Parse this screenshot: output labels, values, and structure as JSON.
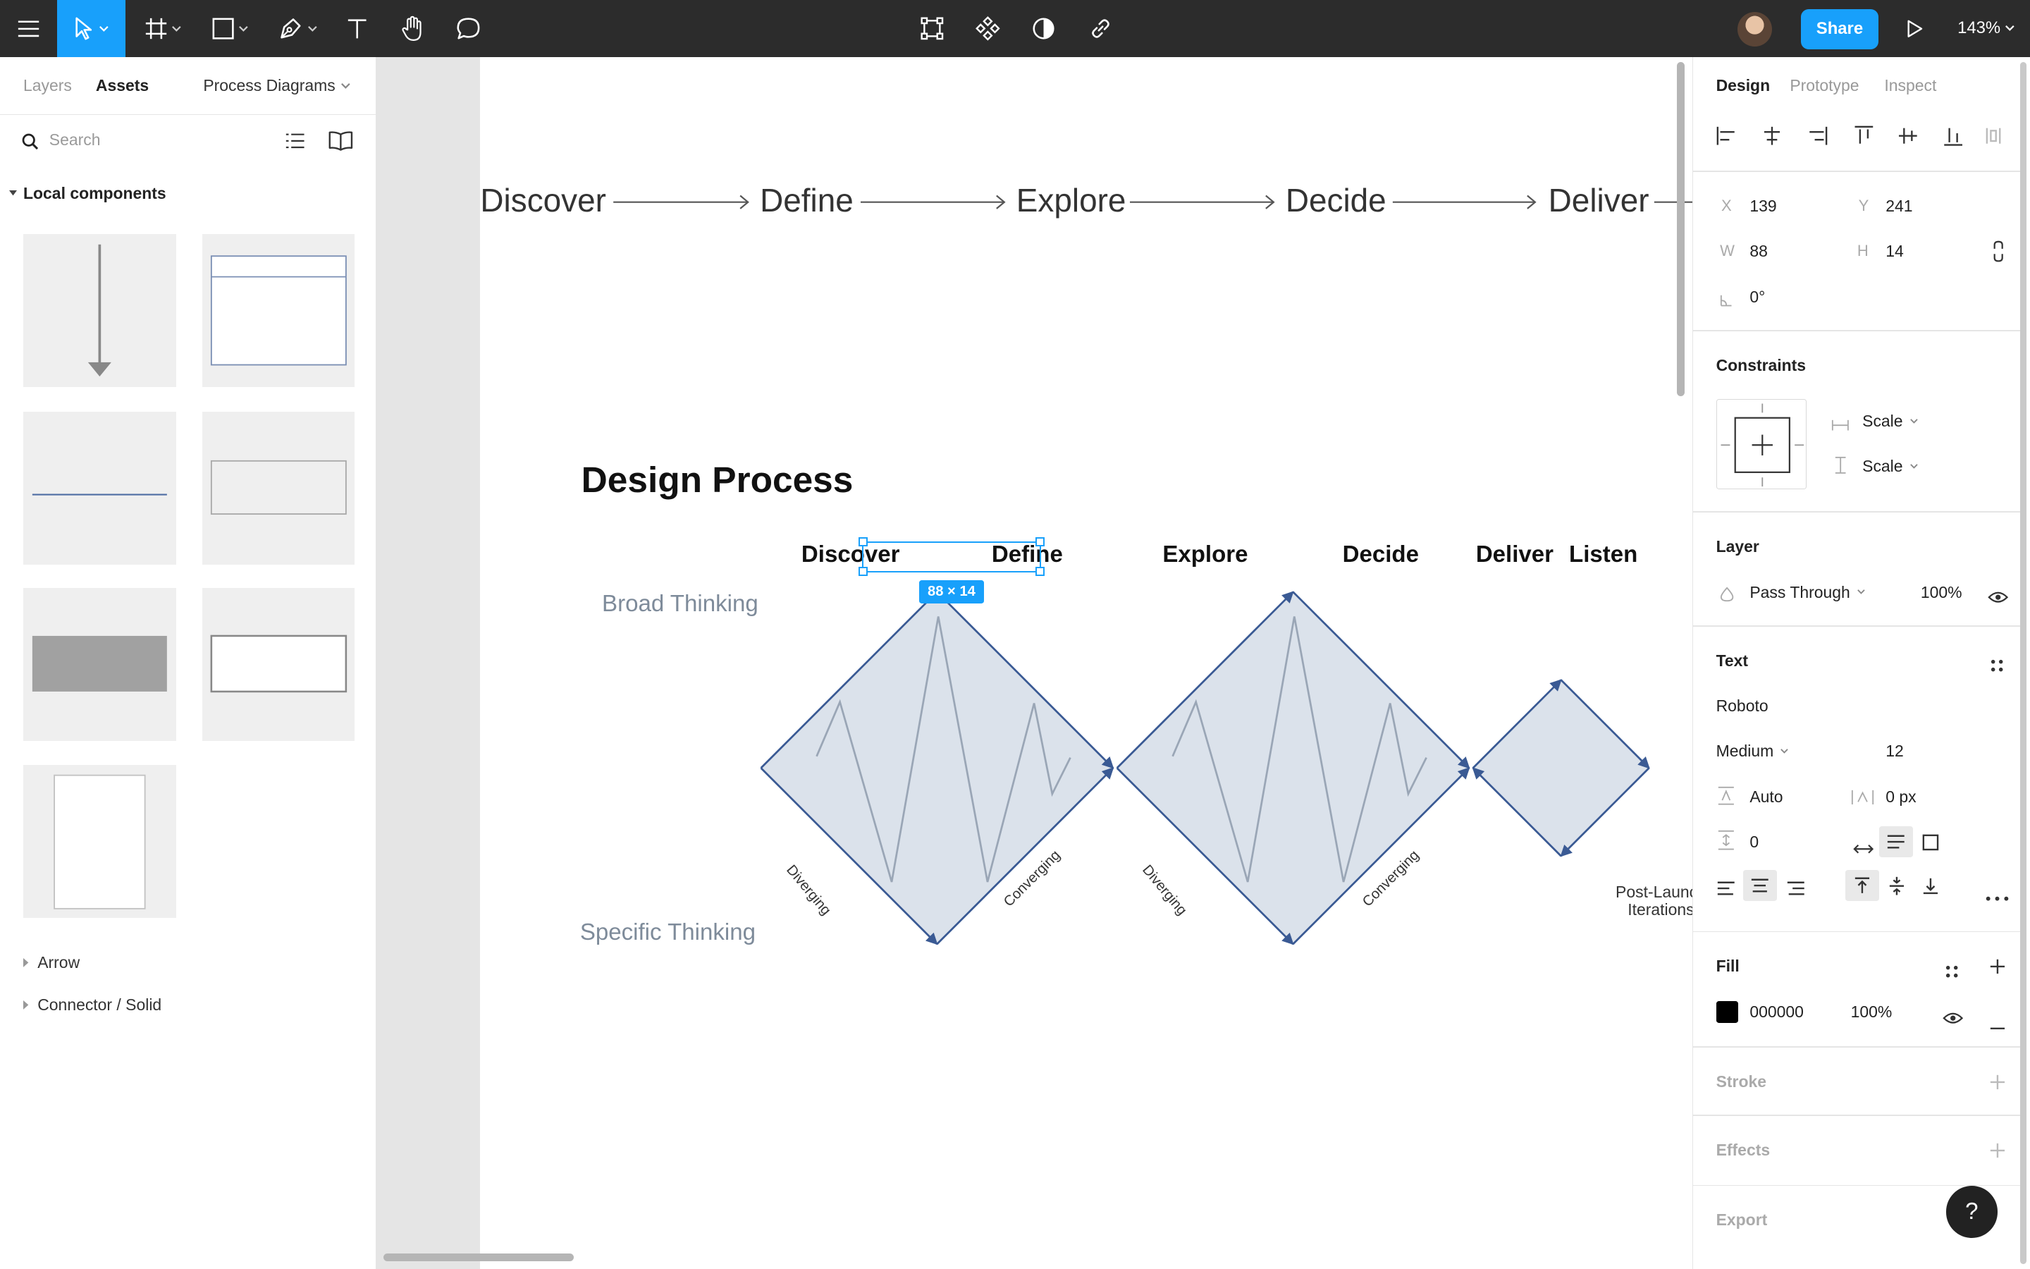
{
  "toolbar": {
    "share_label": "Share",
    "zoom": "143%"
  },
  "left_panel": {
    "tabs": [
      {
        "label": "Layers"
      },
      {
        "label": "Assets"
      }
    ],
    "page_selector": "Process Diagrams",
    "search": {
      "placeholder": "Search",
      "value": ""
    },
    "section_title": "Local components",
    "groups": [
      {
        "label": "Arrow"
      },
      {
        "label": "Connector / Solid"
      }
    ]
  },
  "canvas": {
    "flow_words": [
      "Discover",
      "Define",
      "Explore",
      "Decide",
      "Deliver"
    ],
    "title": "Design Process",
    "phases": [
      "Discover",
      "Define",
      "Explore",
      "Decide",
      "Deliver",
      "Listen"
    ],
    "broad_label": "Broad Thinking",
    "specific_label": "Specific Thinking",
    "diverging_label": "Diverging",
    "converging_label": "Converging",
    "post_launch_label": "Post-Launch Iterations",
    "selection_size": "88 × 14"
  },
  "right_panel": {
    "tabs": [
      {
        "label": "Design"
      },
      {
        "label": "Prototype"
      },
      {
        "label": "Inspect"
      }
    ],
    "transform": {
      "x_label": "X",
      "x": "139",
      "y_label": "Y",
      "y": "241",
      "w_label": "W",
      "w": "88",
      "h_label": "H",
      "h": "14",
      "rotation": "0°"
    },
    "constraints": {
      "title": "Constraints",
      "horizontal": "Scale",
      "vertical": "Scale"
    },
    "layer": {
      "title": "Layer",
      "blend": "Pass Through",
      "opacity": "100%"
    },
    "text": {
      "title": "Text",
      "font_family": "Roboto",
      "font_weight": "Medium",
      "font_size": "12",
      "line_height": "Auto",
      "letter_spacing": "0 px",
      "paragraph_spacing": "0"
    },
    "fill": {
      "title": "Fill",
      "hex": "000000",
      "opacity": "100%",
      "color": "#000000"
    },
    "sections": [
      "Stroke",
      "Effects",
      "Export"
    ]
  },
  "help_label": "?",
  "colors": {
    "accent": "#18a0fb",
    "toolbar": "#2c2c2c",
    "diamond_fill": "#dbe2eb",
    "diamond_stroke": "#3a5a94",
    "wave_stroke": "#9aa6b6"
  }
}
